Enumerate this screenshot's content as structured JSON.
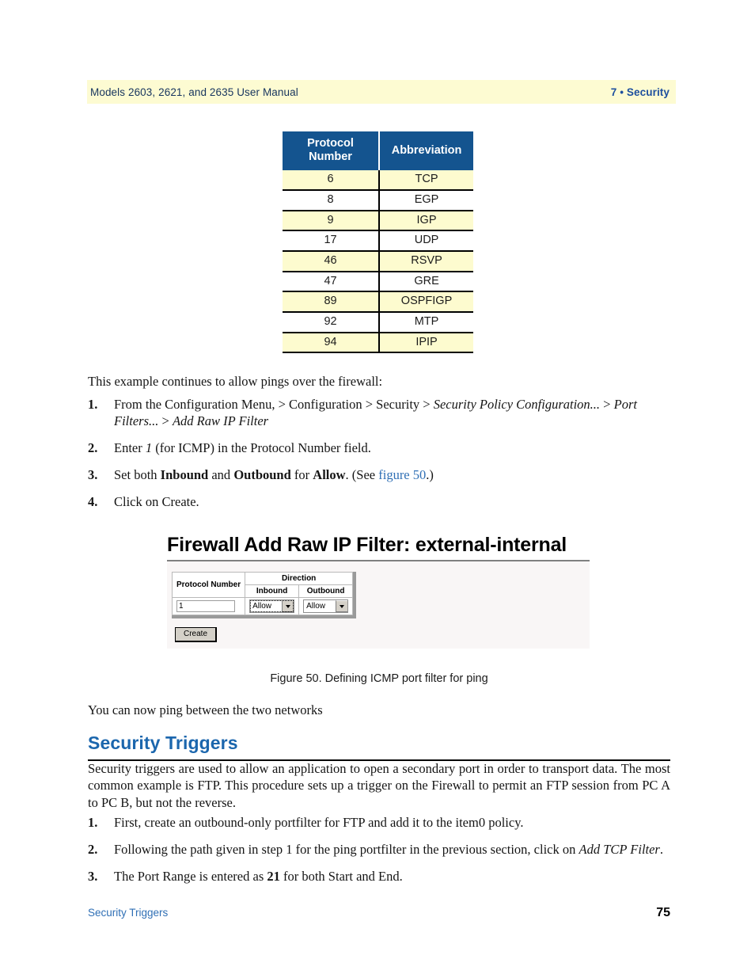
{
  "header": {
    "left": "Models 2603, 2621, and 2635 User Manual",
    "right": "7 • Security"
  },
  "protocol_table": {
    "columns": [
      "Protocol Number",
      "Abbreviation"
    ],
    "header_bg": "#14548f",
    "header_fg": "#ffffff",
    "alt_row_bg": "#fdfbcf",
    "rows": [
      {
        "number": "6",
        "abbreviation": "TCP"
      },
      {
        "number": "8",
        "abbreviation": "EGP"
      },
      {
        "number": "9",
        "abbreviation": "IGP"
      },
      {
        "number": "17",
        "abbreviation": "UDP"
      },
      {
        "number": "46",
        "abbreviation": "RSVP"
      },
      {
        "number": "47",
        "abbreviation": "GRE"
      },
      {
        "number": "89",
        "abbreviation": "OSPFIGP"
      },
      {
        "number": "92",
        "abbreviation": "MTP"
      },
      {
        "number": "94",
        "abbreviation": "IPIP"
      }
    ]
  },
  "intro": "This example continues to allow pings over the firewall:",
  "steps_a": [
    {
      "num": "1.",
      "parts": [
        {
          "t": "From the Configuration Menu, > Configuration > Security > ",
          "s": "normal"
        },
        {
          "t": "Security Policy Configuration...",
          "s": "italic"
        },
        {
          "t": " > ",
          "s": "normal"
        },
        {
          "t": "Port Filters...",
          "s": "italic"
        },
        {
          "t": " > ",
          "s": "normal"
        },
        {
          "t": "Add Raw IP Filter",
          "s": "italic"
        }
      ]
    },
    {
      "num": "2.",
      "parts": [
        {
          "t": "Enter ",
          "s": "normal"
        },
        {
          "t": "1",
          "s": "italic"
        },
        {
          "t": " (for ICMP) in the Protocol Number field.",
          "s": "normal"
        }
      ]
    },
    {
      "num": "3.",
      "parts": [
        {
          "t": "Set both ",
          "s": "normal"
        },
        {
          "t": "Inbound",
          "s": "bold"
        },
        {
          "t": " and ",
          "s": "normal"
        },
        {
          "t": "Outbound",
          "s": "bold"
        },
        {
          "t": " for ",
          "s": "normal"
        },
        {
          "t": "Allow",
          "s": "bold"
        },
        {
          "t": ". (See ",
          "s": "normal"
        },
        {
          "t": "figure 50",
          "s": "xref"
        },
        {
          "t": ".)",
          "s": "normal"
        }
      ]
    },
    {
      "num": "4.",
      "parts": [
        {
          "t": "Click on Create.",
          "s": "normal"
        }
      ]
    }
  ],
  "figure": {
    "title": "Firewall Add Raw IP Filter: external-internal",
    "form": {
      "col_protocol_number": "Protocol Number",
      "group_direction": "Direction",
      "col_inbound": "Inbound",
      "col_outbound": "Outbound",
      "protocol_number_value": "1",
      "inbound_value": "Allow",
      "outbound_value": "Allow",
      "create_button": "Create"
    },
    "caption": "Figure 50. Defining ICMP port filter for ping"
  },
  "after_figure_text": "You can now ping between the two networks",
  "section": {
    "heading": "Security Triggers",
    "heading_color": "#1b66ad",
    "body": "Security triggers are used to allow an application to open a secondary port in order to transport data. The most common example is FTP. This procedure sets up a trigger on the Firewall to permit an FTP session from PC A to PC B, but not the reverse."
  },
  "steps_b": [
    {
      "num": "1.",
      "parts": [
        {
          "t": "First, create an outbound-only portfilter for FTP and add it to the item0 policy.",
          "s": "normal"
        }
      ]
    },
    {
      "num": "2.",
      "parts": [
        {
          "t": "Following the path given in step 1 for the ping portfilter in the previous section, click on ",
          "s": "normal"
        },
        {
          "t": "Add TCP Filter",
          "s": "italic"
        },
        {
          "t": ".",
          "s": "normal"
        }
      ]
    },
    {
      "num": "3.",
      "parts": [
        {
          "t": "The Port Range is entered as ",
          "s": "normal"
        },
        {
          "t": "21",
          "s": "bold"
        },
        {
          "t": " for both Start and End.",
          "s": "normal"
        }
      ]
    }
  ],
  "footer": {
    "left": "Security Triggers",
    "page_number": "75"
  }
}
